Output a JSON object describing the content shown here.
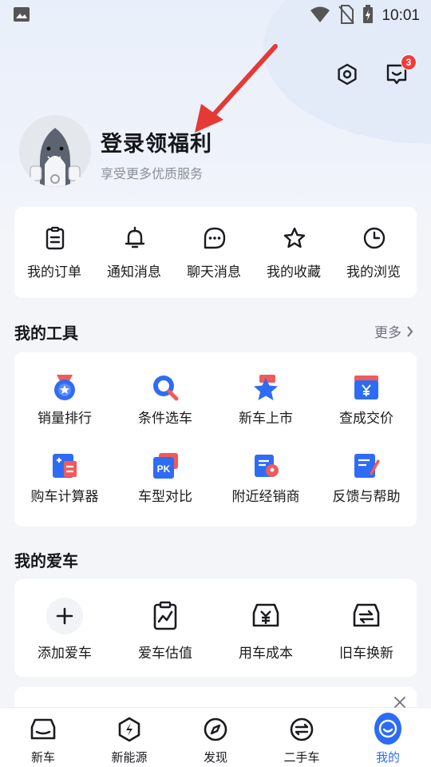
{
  "status_bar": {
    "time": "10:01"
  },
  "header": {
    "message_badge": "3"
  },
  "profile": {
    "name": "登录领福利",
    "subtitle": "享受更多优质服务"
  },
  "quick_actions": [
    {
      "label": "我的订单",
      "icon": "clipboard-icon"
    },
    {
      "label": "通知消息",
      "icon": "bell-icon"
    },
    {
      "label": "聊天消息",
      "icon": "chat-bubble-icon"
    },
    {
      "label": "我的收藏",
      "icon": "star-icon"
    },
    {
      "label": "我的浏览",
      "icon": "clock-icon"
    }
  ],
  "tools": {
    "title": "我的工具",
    "more": "更多",
    "items": [
      {
        "label": "销量排行",
        "icon": "medal-icon"
      },
      {
        "label": "条件选车",
        "icon": "search-icon"
      },
      {
        "label": "新车上市",
        "icon": "new-car-star-icon"
      },
      {
        "label": "查成交价",
        "icon": "price-yen-icon"
      },
      {
        "label": "购车计算器",
        "icon": "calculator-icon"
      },
      {
        "label": "车型对比",
        "icon": "pk-compare-icon"
      },
      {
        "label": "附近经销商",
        "icon": "dealer-location-icon"
      },
      {
        "label": "反馈与帮助",
        "icon": "feedback-edit-icon"
      }
    ]
  },
  "my_car": {
    "title": "我的爱车",
    "items": [
      {
        "label": "添加爱车",
        "icon": "plus-icon"
      },
      {
        "label": "爱车估值",
        "icon": "valuation-chart-icon"
      },
      {
        "label": "用车成本",
        "icon": "car-cost-yen-icon"
      },
      {
        "label": "旧车换新",
        "icon": "car-trade-in-icon"
      }
    ]
  },
  "bottom_nav": [
    {
      "label": "新车",
      "icon": "car-icon"
    },
    {
      "label": "新能源",
      "icon": "lightning-icon"
    },
    {
      "label": "发现",
      "icon": "compass-icon"
    },
    {
      "label": "二手车",
      "icon": "used-car-icon"
    },
    {
      "label": "我的",
      "icon": "profile-smile-icon",
      "active": true
    }
  ],
  "colors": {
    "accent": "#2b6cf6",
    "badge": "#f23b3b",
    "arrow": "#e53935",
    "background": "#f3f5f9"
  }
}
